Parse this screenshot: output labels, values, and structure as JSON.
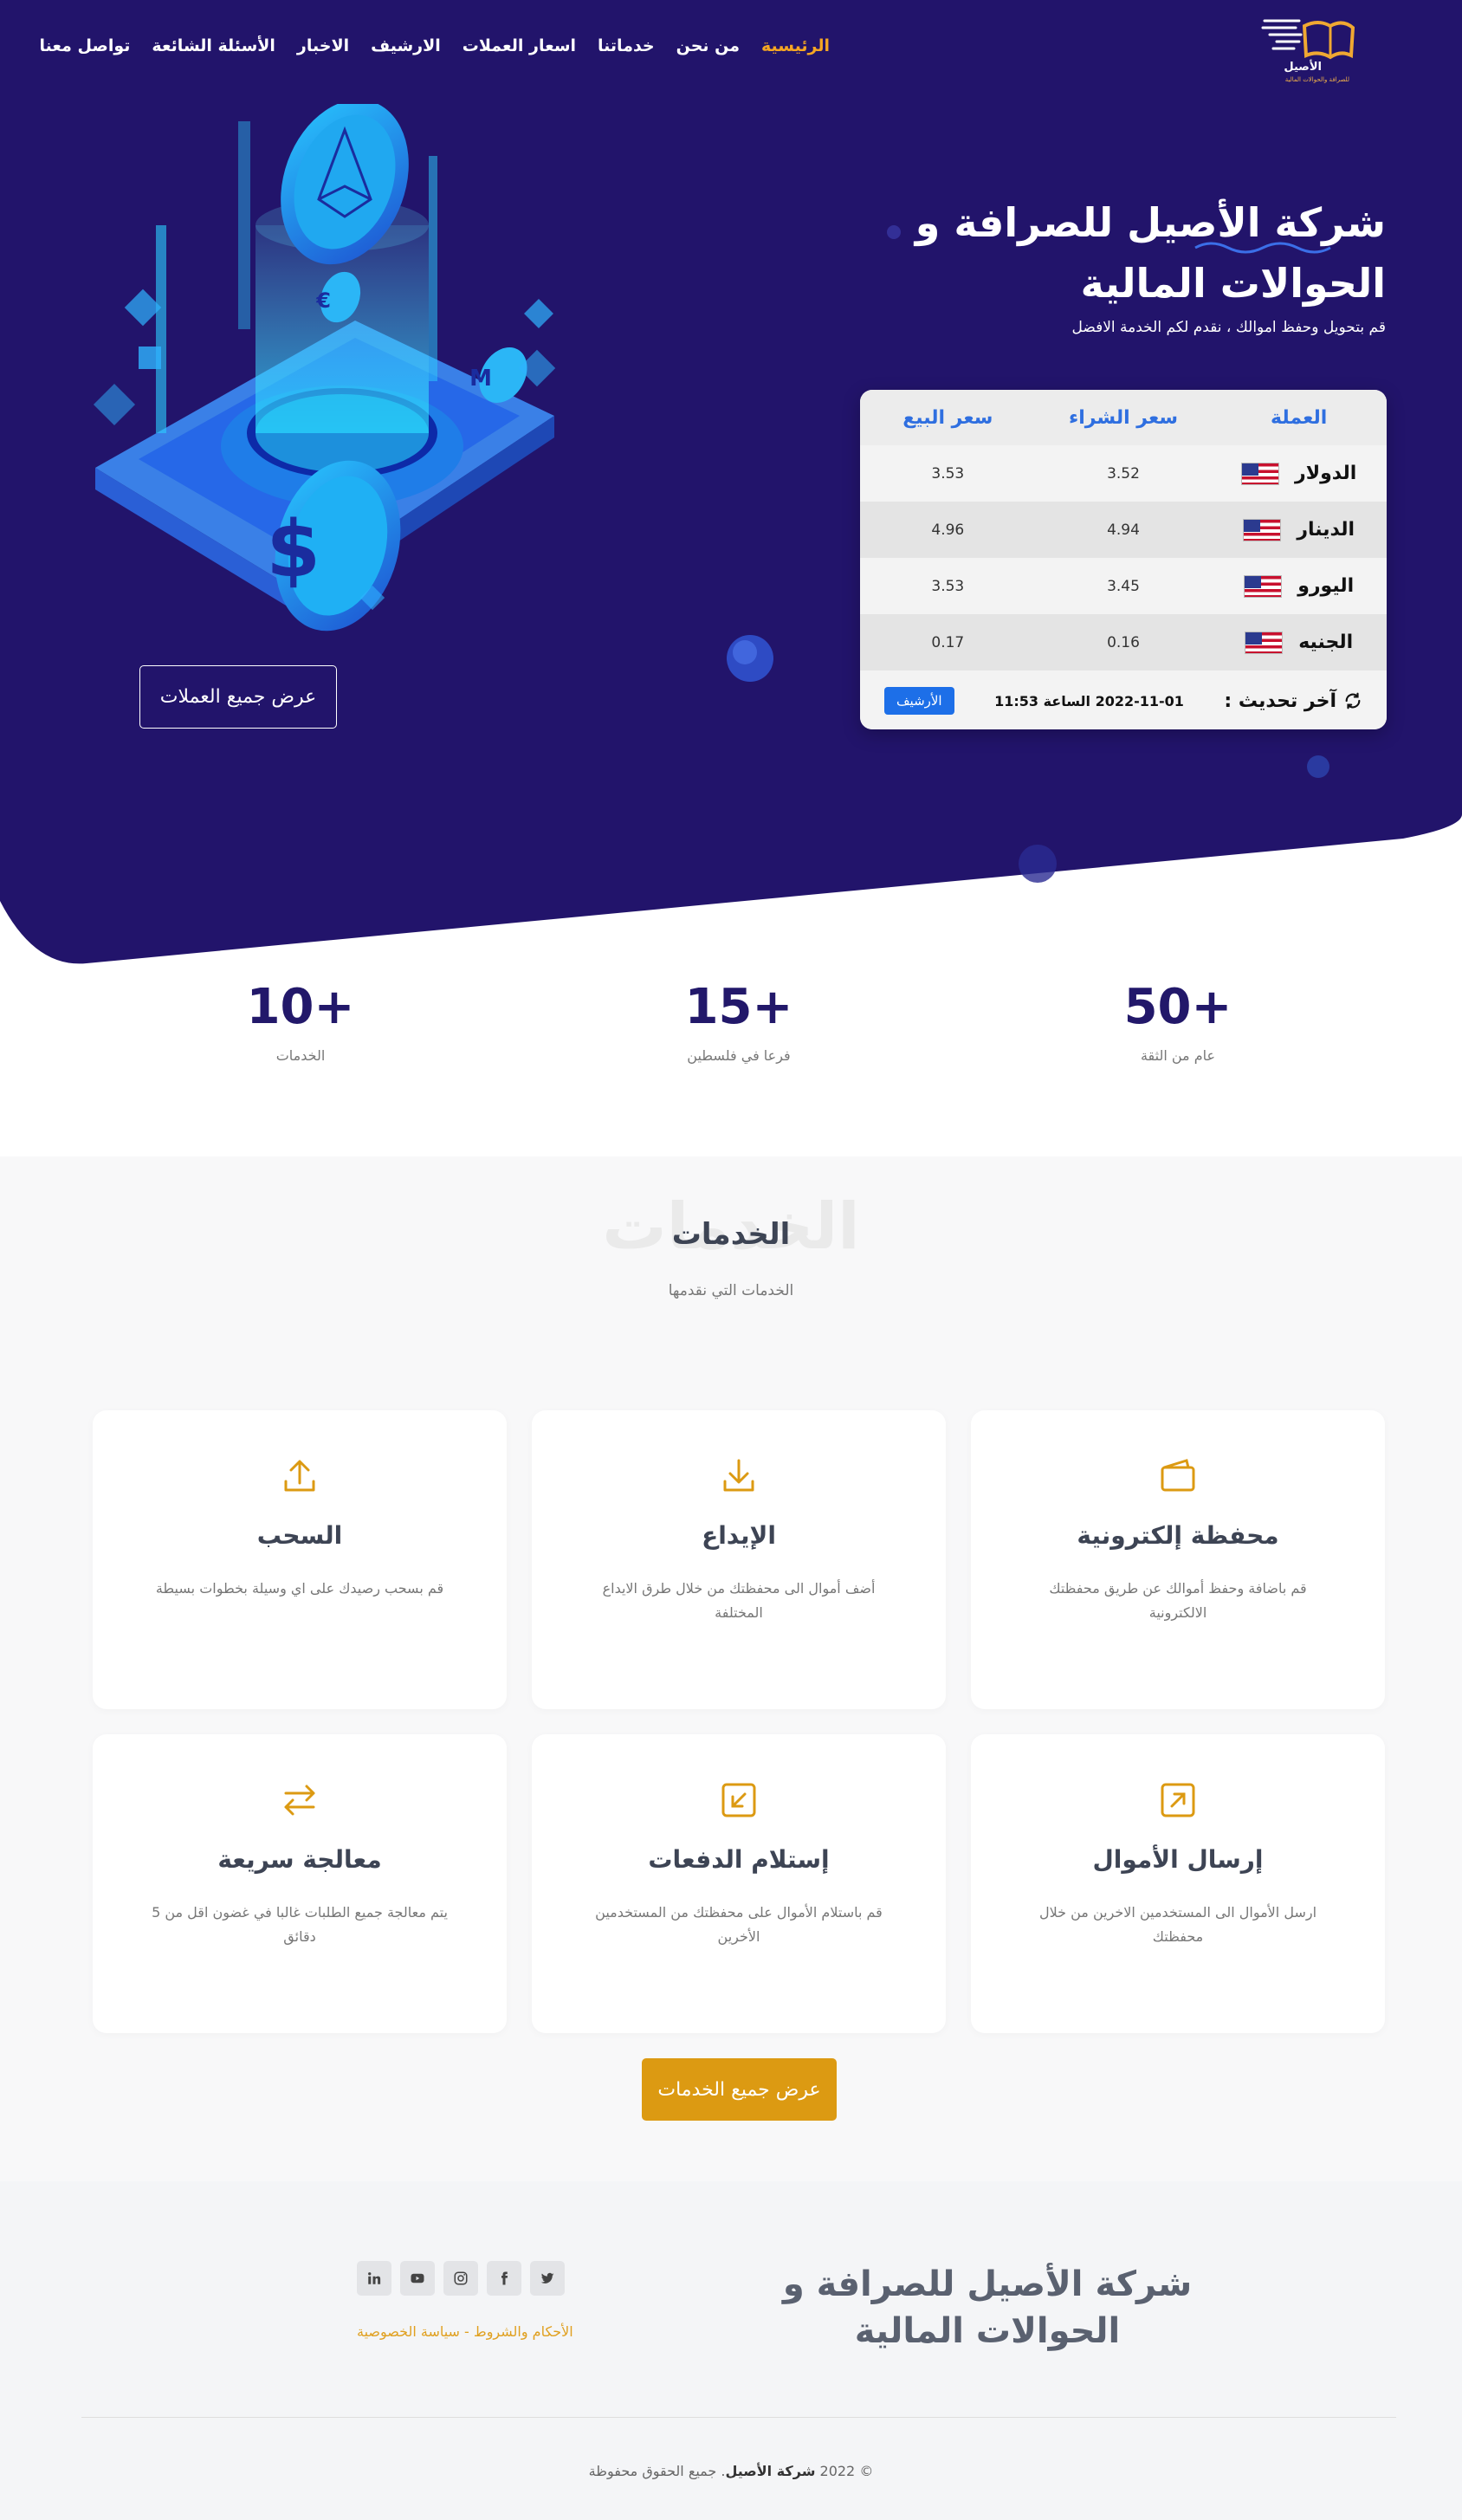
{
  "brand": {
    "logo_name": "الأصيل",
    "logo_tagline": "للصرافة والحوالات المالية"
  },
  "nav": {
    "home": "الرئيسية",
    "about": "من نحن",
    "services": "خدماتنا",
    "prices": "اسعار العملات",
    "archive": "الارشيف",
    "news": "الاخبار",
    "faq": "الأسئلة الشائعة",
    "contact": "تواصل معنا"
  },
  "hero": {
    "title": "شركة الأصيل للصرافة و الحوالات المالية",
    "subtitle": "قم بتحويل وحفظ اموالك ، نقدم لكم الخدمة الافضل",
    "all_currencies": "عرض جميع العملات"
  },
  "rates": {
    "headers": [
      "العملة",
      "سعر الشراء",
      "سعر البيع"
    ],
    "rows": [
      {
        "currency": "الدولار",
        "buy": "3.52",
        "sell": "3.53"
      },
      {
        "currency": "الدينار",
        "buy": "4.94",
        "sell": "4.96"
      },
      {
        "currency": "اليورو",
        "buy": "3.45",
        "sell": "3.53"
      },
      {
        "currency": "الجنيه",
        "buy": "0.16",
        "sell": "0.17"
      }
    ],
    "update_label": "آخر تحديث :",
    "update_time": "2022-11-01 الساعة 11:53",
    "archive_button": "الأرشيف"
  },
  "stats": [
    {
      "value": "50+",
      "label": "عام من الثقة"
    },
    {
      "value": "15+",
      "label": "فرعا في فلسطين"
    },
    {
      "value": "10+",
      "label": "الخدمات"
    }
  ],
  "services": {
    "ghost": "الخدمات",
    "title": "الخدمات",
    "subtitle": "الخدمات التي نقدمها",
    "cards": [
      {
        "icon": "wallet-icon",
        "title": "محفظة إلكترونية",
        "desc": "قم باضافة وحفظ أموالك عن طريق محفظتك الالكترونية"
      },
      {
        "icon": "deposit-icon",
        "title": "الإيداع",
        "desc": "أضف أموال الى محفظتك من خلال طرق الايداع المختلفة"
      },
      {
        "icon": "withdraw-icon",
        "title": "السحب",
        "desc": "قم بسحب رصيدك على اي وسيلة بخطوات بسيطة"
      },
      {
        "icon": "send-money-icon",
        "title": "إرسال الأموال",
        "desc": "ارسل الأموال الى المستخدمين الاخرين من خلال محفظتك"
      },
      {
        "icon": "receive-payment-icon",
        "title": "إستلام الدفعات",
        "desc": "قم باستلام الأموال على محفظتك من المستخدمين الأخرين"
      },
      {
        "icon": "exchange-icon",
        "title": "معالجة سريعة",
        "desc": "يتم معالجة جميع الطلبات غالبا في غضون اقل من 5 دقائق"
      }
    ],
    "all_services": "عرض جميع الخدمات"
  },
  "footer": {
    "title": "شركة الأصيل للصرافة و الحوالات المالية",
    "socials": [
      "twitter-icon",
      "facebook-icon",
      "instagram-icon",
      "youtube-icon",
      "linkedin-icon"
    ],
    "terms": "الأحكام والشروط - سياسة الخصوصية",
    "copyright_prefix": "© 2022",
    "copyright_company": "شركة الأصيل",
    "copyright_suffix": ". جميع الحقوق محفوظة"
  },
  "colors": {
    "hero_bg": "#22146b",
    "accent": "#f5a623",
    "button_gold": "#dc9a12",
    "link_blue": "#2f6fe0",
    "archive_blue": "#1d6fe8"
  }
}
